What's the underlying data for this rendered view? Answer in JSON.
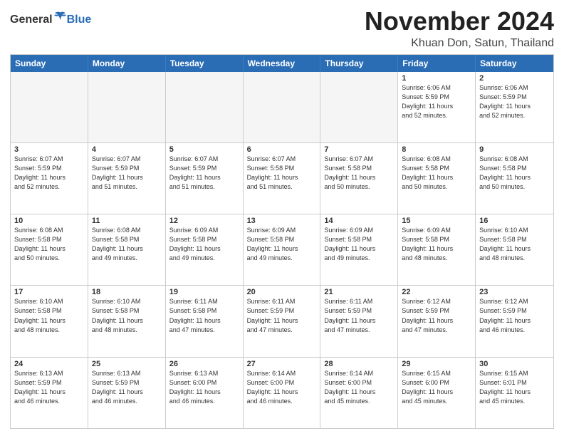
{
  "logo": {
    "general": "General",
    "blue": "Blue"
  },
  "title": "November 2024",
  "location": "Khuan Don, Satun, Thailand",
  "header_days": [
    "Sunday",
    "Monday",
    "Tuesday",
    "Wednesday",
    "Thursday",
    "Friday",
    "Saturday"
  ],
  "weeks": [
    [
      {
        "day": "",
        "info": "",
        "empty": true
      },
      {
        "day": "",
        "info": "",
        "empty": true
      },
      {
        "day": "",
        "info": "",
        "empty": true
      },
      {
        "day": "",
        "info": "",
        "empty": true
      },
      {
        "day": "",
        "info": "",
        "empty": true
      },
      {
        "day": "1",
        "info": "Sunrise: 6:06 AM\nSunset: 5:59 PM\nDaylight: 11 hours\nand 52 minutes."
      },
      {
        "day": "2",
        "info": "Sunrise: 6:06 AM\nSunset: 5:59 PM\nDaylight: 11 hours\nand 52 minutes."
      }
    ],
    [
      {
        "day": "3",
        "info": "Sunrise: 6:07 AM\nSunset: 5:59 PM\nDaylight: 11 hours\nand 52 minutes."
      },
      {
        "day": "4",
        "info": "Sunrise: 6:07 AM\nSunset: 5:59 PM\nDaylight: 11 hours\nand 51 minutes."
      },
      {
        "day": "5",
        "info": "Sunrise: 6:07 AM\nSunset: 5:59 PM\nDaylight: 11 hours\nand 51 minutes."
      },
      {
        "day": "6",
        "info": "Sunrise: 6:07 AM\nSunset: 5:58 PM\nDaylight: 11 hours\nand 51 minutes."
      },
      {
        "day": "7",
        "info": "Sunrise: 6:07 AM\nSunset: 5:58 PM\nDaylight: 11 hours\nand 50 minutes."
      },
      {
        "day": "8",
        "info": "Sunrise: 6:08 AM\nSunset: 5:58 PM\nDaylight: 11 hours\nand 50 minutes."
      },
      {
        "day": "9",
        "info": "Sunrise: 6:08 AM\nSunset: 5:58 PM\nDaylight: 11 hours\nand 50 minutes."
      }
    ],
    [
      {
        "day": "10",
        "info": "Sunrise: 6:08 AM\nSunset: 5:58 PM\nDaylight: 11 hours\nand 50 minutes."
      },
      {
        "day": "11",
        "info": "Sunrise: 6:08 AM\nSunset: 5:58 PM\nDaylight: 11 hours\nand 49 minutes."
      },
      {
        "day": "12",
        "info": "Sunrise: 6:09 AM\nSunset: 5:58 PM\nDaylight: 11 hours\nand 49 minutes."
      },
      {
        "day": "13",
        "info": "Sunrise: 6:09 AM\nSunset: 5:58 PM\nDaylight: 11 hours\nand 49 minutes."
      },
      {
        "day": "14",
        "info": "Sunrise: 6:09 AM\nSunset: 5:58 PM\nDaylight: 11 hours\nand 49 minutes."
      },
      {
        "day": "15",
        "info": "Sunrise: 6:09 AM\nSunset: 5:58 PM\nDaylight: 11 hours\nand 48 minutes."
      },
      {
        "day": "16",
        "info": "Sunrise: 6:10 AM\nSunset: 5:58 PM\nDaylight: 11 hours\nand 48 minutes."
      }
    ],
    [
      {
        "day": "17",
        "info": "Sunrise: 6:10 AM\nSunset: 5:58 PM\nDaylight: 11 hours\nand 48 minutes."
      },
      {
        "day": "18",
        "info": "Sunrise: 6:10 AM\nSunset: 5:58 PM\nDaylight: 11 hours\nand 48 minutes."
      },
      {
        "day": "19",
        "info": "Sunrise: 6:11 AM\nSunset: 5:58 PM\nDaylight: 11 hours\nand 47 minutes."
      },
      {
        "day": "20",
        "info": "Sunrise: 6:11 AM\nSunset: 5:59 PM\nDaylight: 11 hours\nand 47 minutes."
      },
      {
        "day": "21",
        "info": "Sunrise: 6:11 AM\nSunset: 5:59 PM\nDaylight: 11 hours\nand 47 minutes."
      },
      {
        "day": "22",
        "info": "Sunrise: 6:12 AM\nSunset: 5:59 PM\nDaylight: 11 hours\nand 47 minutes."
      },
      {
        "day": "23",
        "info": "Sunrise: 6:12 AM\nSunset: 5:59 PM\nDaylight: 11 hours\nand 46 minutes."
      }
    ],
    [
      {
        "day": "24",
        "info": "Sunrise: 6:13 AM\nSunset: 5:59 PM\nDaylight: 11 hours\nand 46 minutes."
      },
      {
        "day": "25",
        "info": "Sunrise: 6:13 AM\nSunset: 5:59 PM\nDaylight: 11 hours\nand 46 minutes."
      },
      {
        "day": "26",
        "info": "Sunrise: 6:13 AM\nSunset: 6:00 PM\nDaylight: 11 hours\nand 46 minutes."
      },
      {
        "day": "27",
        "info": "Sunrise: 6:14 AM\nSunset: 6:00 PM\nDaylight: 11 hours\nand 46 minutes."
      },
      {
        "day": "28",
        "info": "Sunrise: 6:14 AM\nSunset: 6:00 PM\nDaylight: 11 hours\nand 45 minutes."
      },
      {
        "day": "29",
        "info": "Sunrise: 6:15 AM\nSunset: 6:00 PM\nDaylight: 11 hours\nand 45 minutes."
      },
      {
        "day": "30",
        "info": "Sunrise: 6:15 AM\nSunset: 6:01 PM\nDaylight: 11 hours\nand 45 minutes."
      }
    ]
  ]
}
